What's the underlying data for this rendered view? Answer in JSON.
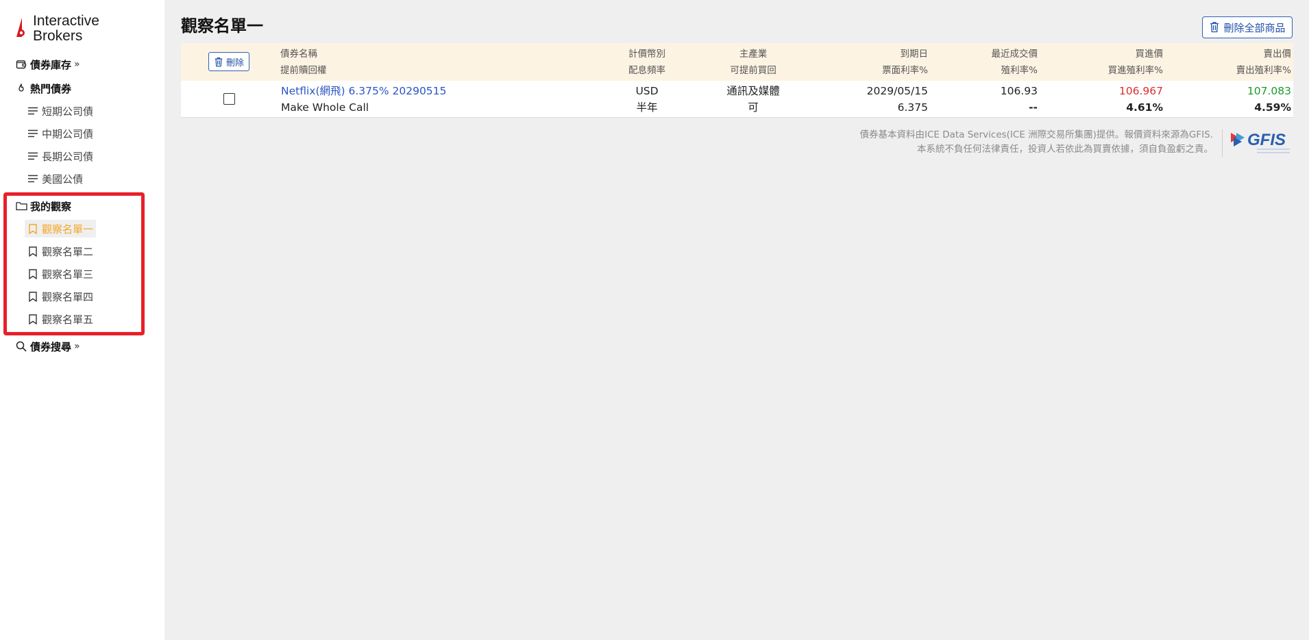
{
  "brand": {
    "line1": "Interactive",
    "line2": "Brokers"
  },
  "sidebar": {
    "inventory": {
      "label": "債券庫存",
      "chevron": "»"
    },
    "hot": {
      "label": "熱門債券"
    },
    "hot_items": [
      {
        "label": "短期公司債"
      },
      {
        "label": "中期公司債"
      },
      {
        "label": "長期公司債"
      },
      {
        "label": "美國公債"
      }
    ],
    "watch": {
      "label": "我的觀察"
    },
    "watch_items": [
      {
        "label": "觀察名單一"
      },
      {
        "label": "觀察名單二"
      },
      {
        "label": "觀察名單三"
      },
      {
        "label": "觀察名單四"
      },
      {
        "label": "觀察名單五"
      }
    ],
    "search": {
      "label": "債券搜尋",
      "chevron": "»"
    }
  },
  "main": {
    "title": "觀察名單一",
    "delete_all_label": "刪除全部商品",
    "delete_label": "刪除"
  },
  "table": {
    "headers": {
      "name": [
        "債券名稱",
        "提前贖回權"
      ],
      "currency": [
        "計價幣別",
        "配息頻率"
      ],
      "industry": [
        "主產業",
        "可提前買回"
      ],
      "maturity": [
        "到期日",
        "票面利率%"
      ],
      "last": [
        "最近成交價",
        "殖利率%"
      ],
      "bid": [
        "買進價",
        "買進殖利率%"
      ],
      "ask": [
        "賣出價",
        "賣出殖利率%"
      ]
    },
    "rows": [
      {
        "name": "Netflix(網飛) 6.375% 20290515",
        "call": "Make Whole Call",
        "currency": "USD",
        "frequency": "半年",
        "industry": "通訊及媒體",
        "callable": "可",
        "maturity": "2029/05/15",
        "coupon": "6.375",
        "last_price": "106.93",
        "last_yield": "--",
        "bid_price": "106.967",
        "bid_yield": "4.61%",
        "ask_price": "107.083",
        "ask_yield": "4.59%"
      }
    ]
  },
  "disclaimer": {
    "line1": "債券基本資料由ICE Data Services(ICE 洲際交易所集團)提供。報價資料來源為GFIS.",
    "line2": "本系統不負任何法律責任，投資人若依此為買賣依據，須自負盈虧之責。"
  },
  "gfis": {
    "name": "GFIS"
  },
  "colors": {
    "accent_blue": "#2d5fb8",
    "active_orange": "#f5a623",
    "bid_red": "#d93030",
    "ask_green": "#1b9a2a",
    "highlight_red": "#e8202a"
  }
}
